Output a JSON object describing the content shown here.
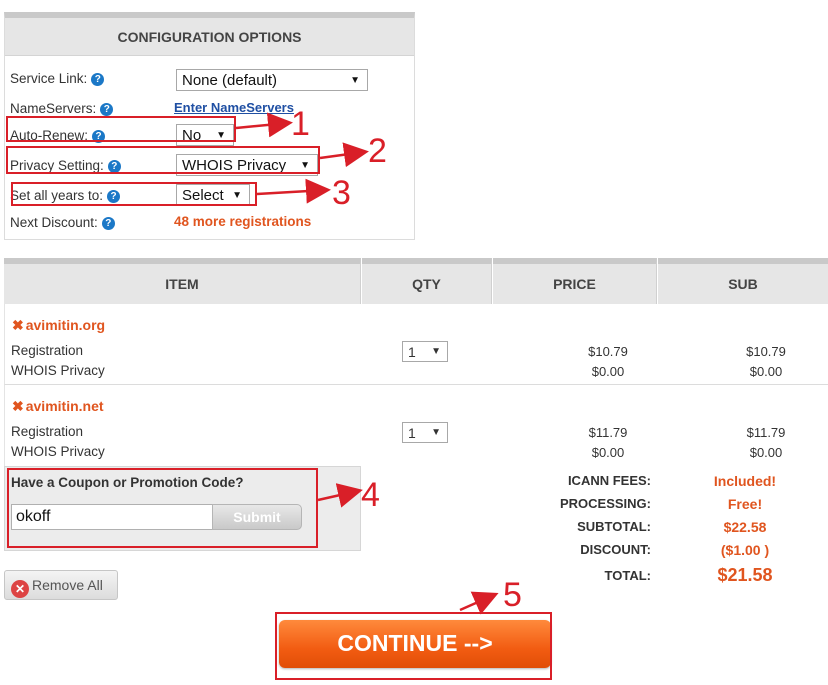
{
  "config": {
    "title": "CONFIGURATION OPTIONS",
    "service_link": {
      "label": "Service Link:",
      "value": "None (default)"
    },
    "nameservers": {
      "label": "NameServers:",
      "link": "Enter NameServers"
    },
    "auto_renew": {
      "label": "Auto-Renew:",
      "value": "No"
    },
    "privacy": {
      "label": "Privacy Setting:",
      "value": "WHOIS Privacy"
    },
    "set_years": {
      "label": "Set all years to:",
      "value": "Select"
    },
    "next_discount": {
      "label": "Next Discount:",
      "value": "48 more registrations"
    }
  },
  "cart": {
    "headers": [
      "ITEM",
      "QTY",
      "PRICE",
      "SUB"
    ],
    "items": [
      {
        "domain": "avimitin.org",
        "lines": [
          "Registration",
          "WHOIS Privacy"
        ],
        "qty": "1",
        "prices": [
          "$10.79",
          "$0.00"
        ],
        "subs": [
          "$10.79",
          "$0.00"
        ]
      },
      {
        "domain": "avimitin.net",
        "lines": [
          "Registration",
          "WHOIS Privacy"
        ],
        "qty": "1",
        "prices": [
          "$11.79",
          "$0.00"
        ],
        "subs": [
          "$11.79",
          "$0.00"
        ]
      }
    ]
  },
  "coupon": {
    "label": "Have a Coupon or Promotion Code?",
    "value": "okoff",
    "button": "Submit"
  },
  "totals": [
    {
      "label": "ICANN FEES:",
      "value": "Included!"
    },
    {
      "label": "PROCESSING:",
      "value": "Free!"
    },
    {
      "label": "SUBTOTAL:",
      "value": "$22.58"
    },
    {
      "label": "DISCOUNT:",
      "value": "($1.00 )"
    },
    {
      "label": "TOTAL:",
      "value": "$21.58"
    }
  ],
  "remove_all": "Remove All",
  "continue": "CONTINUE -->",
  "annotations": [
    "1",
    "2",
    "3",
    "4",
    "5"
  ],
  "colors": {
    "accent": "#e0551f",
    "annotation": "#d91f28",
    "link": "#1f4fa3",
    "help": "#1b78c7"
  }
}
